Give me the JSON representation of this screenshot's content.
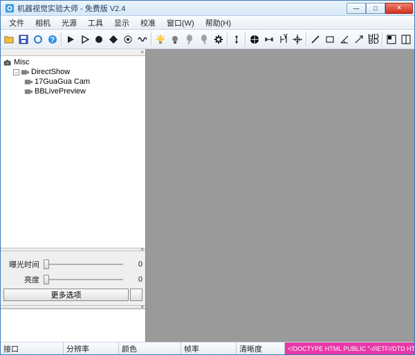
{
  "window": {
    "title": "机器视觉实验大师 - 免费版 V2.4"
  },
  "menu": [
    "文件",
    "相机",
    "光源",
    "工具",
    "显示",
    "校准",
    "窗口(W)",
    "帮助(H)"
  ],
  "tree": {
    "root": "Misc",
    "folder": "DirectShow",
    "items": [
      "17GuaGua Cam",
      "BBLivePreview"
    ]
  },
  "controls": {
    "exposure_label": "曝光时间",
    "brightness_label": "亮度",
    "exposure_value": "0",
    "brightness_value": "0",
    "more_label": "更多选项"
  },
  "status": {
    "port": "接口",
    "resolution": "分辨率",
    "color": "颜色",
    "fps": "帧率",
    "clarity": "清晰度",
    "doctype": "<!DOCTYPE HTML PUBLIC \"-//IETF//DTD HTML 2.0/"
  }
}
